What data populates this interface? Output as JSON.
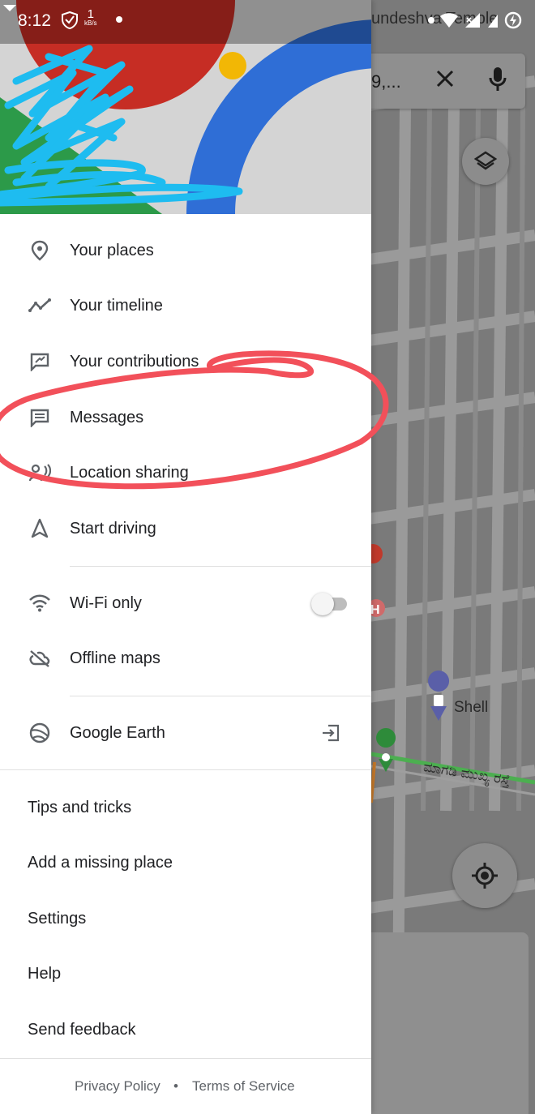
{
  "status_bar": {
    "time": "8:12",
    "data_rate_value": "1",
    "data_rate_unit": "kB/s",
    "behind_text": "undeshva Temple"
  },
  "map": {
    "search_query": "9,...",
    "poi_label": "Shell",
    "road_label": "ಮಾಗಡಿ ಮುಖ್ಯ ರಸ್ತೆ"
  },
  "drawer": {
    "menu_items": [
      {
        "label": "Your places",
        "icon": "location-pin-icon"
      },
      {
        "label": "Your timeline",
        "icon": "timeline-icon"
      },
      {
        "label": "Your contributions",
        "icon": "contributions-icon"
      },
      {
        "label": "Messages",
        "icon": "message-icon"
      },
      {
        "label": "Location sharing",
        "icon": "location-sharing-icon"
      },
      {
        "label": "Start driving",
        "icon": "navigation-arrow-icon"
      }
    ],
    "wifi_only": {
      "label": "Wi-Fi only",
      "icon": "wifi-icon",
      "enabled": false
    },
    "offline_maps": {
      "label": "Offline maps",
      "icon": "cloud-off-icon"
    },
    "google_earth": {
      "label": "Google Earth",
      "icon": "earth-icon",
      "action_icon": "open-external-icon"
    },
    "links": [
      "Tips and tricks",
      "Add a missing place",
      "Settings",
      "Help",
      "Send feedback"
    ],
    "footer": {
      "privacy": "Privacy Policy",
      "separator": "•",
      "terms": "Terms of Service"
    }
  },
  "colors": {
    "annotation": "#f2505a",
    "scribble": "#1ebcf0",
    "header_red": "#c62d24",
    "header_blue": "#2f6ed6",
    "header_green": "#2c9a49",
    "header_yellow": "#f2b705"
  }
}
